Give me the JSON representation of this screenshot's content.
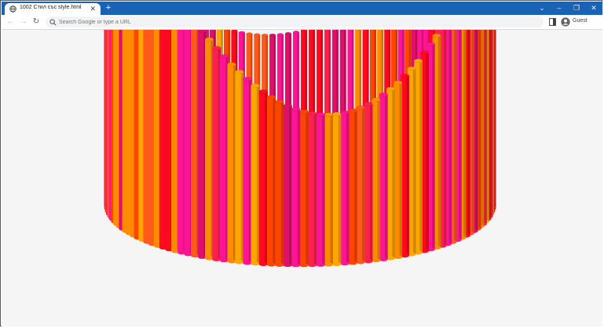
{
  "browser": {
    "tab": {
      "title": "1002 Стил със style.html",
      "close_glyph": "✕",
      "favicon": "globe-icon"
    },
    "new_tab_glyph": "+",
    "window_controls": {
      "list": "⌄",
      "minimize": "–",
      "restore": "❐",
      "close": "✕"
    },
    "nav": {
      "back": "←",
      "forward": "→",
      "reload": "↻"
    },
    "omnibox": {
      "placeholder": "Search Google or type a URL"
    },
    "profile": {
      "label": "Guest"
    },
    "colors": {
      "tabstrip": "#1a62b4",
      "viewport": "#f5f5f5"
    }
  },
  "scene": {
    "description_colors": [
      "#ff0a1e",
      "#ff1493",
      "#ff4500",
      "#ff8c00",
      "#ff2050",
      "#ff5a1a",
      "#e0106a",
      "#ffa500"
    ]
  }
}
